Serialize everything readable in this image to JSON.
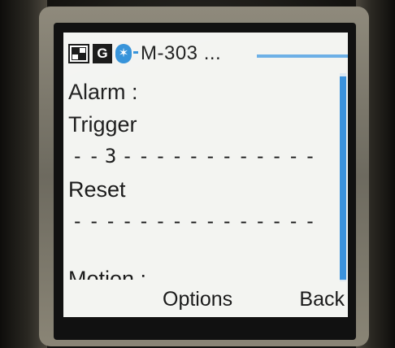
{
  "status_bar": {
    "network_icon": "network-mode-icon",
    "gprs_label": "G",
    "bluetooth_icon": "bluetooth-icon",
    "title": "M-303 ...",
    "accent_color": "#2f8fd8"
  },
  "content": {
    "alarm_label": "Alarm :",
    "trigger_label": "Trigger",
    "trigger_value": "--3------------",
    "reset_label": "Reset",
    "reset_value": "---------------",
    "motion_label": "Motion :"
  },
  "softkeys": {
    "left": "Options",
    "right": "Back"
  }
}
